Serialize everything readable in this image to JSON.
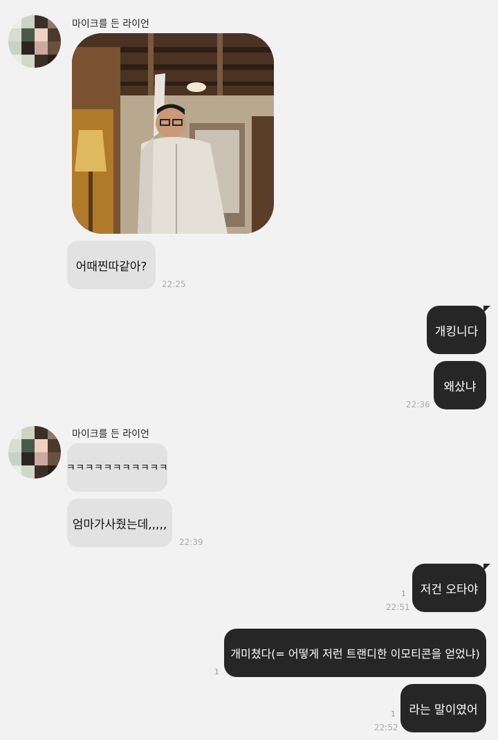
{
  "chat": {
    "contact_name": "마이크를 든 라이언",
    "groups": [
      {
        "sender": "마이크를 든 라이언",
        "photo_alt": "photo",
        "messages": [
          "어때찐따같아?"
        ],
        "time": "22:25"
      },
      {
        "sender": "me",
        "messages": [
          "개킹니다",
          "왜샀냐"
        ],
        "time": "22:36"
      },
      {
        "sender": "마이크를 든 라이언",
        "messages": [
          "ㅋㅋㅋㅋㅋㅋㅋㅋㅋㅋㅋ",
          "엄마가사줬는데,,,,,"
        ],
        "time": "22:39"
      },
      {
        "sender": "me",
        "messages": [
          "저건 오타야"
        ],
        "time": "22:51",
        "unread": "1"
      },
      {
        "sender": "me",
        "messages": [
          "개미쳤다(= 어떻게 저런 트랜디한 이모티콘을 얻었냐)"
        ],
        "unread": "1"
      },
      {
        "sender": "me",
        "messages": [
          "라는 말이였어"
        ],
        "time": "22:52",
        "unread": "1"
      }
    ]
  }
}
